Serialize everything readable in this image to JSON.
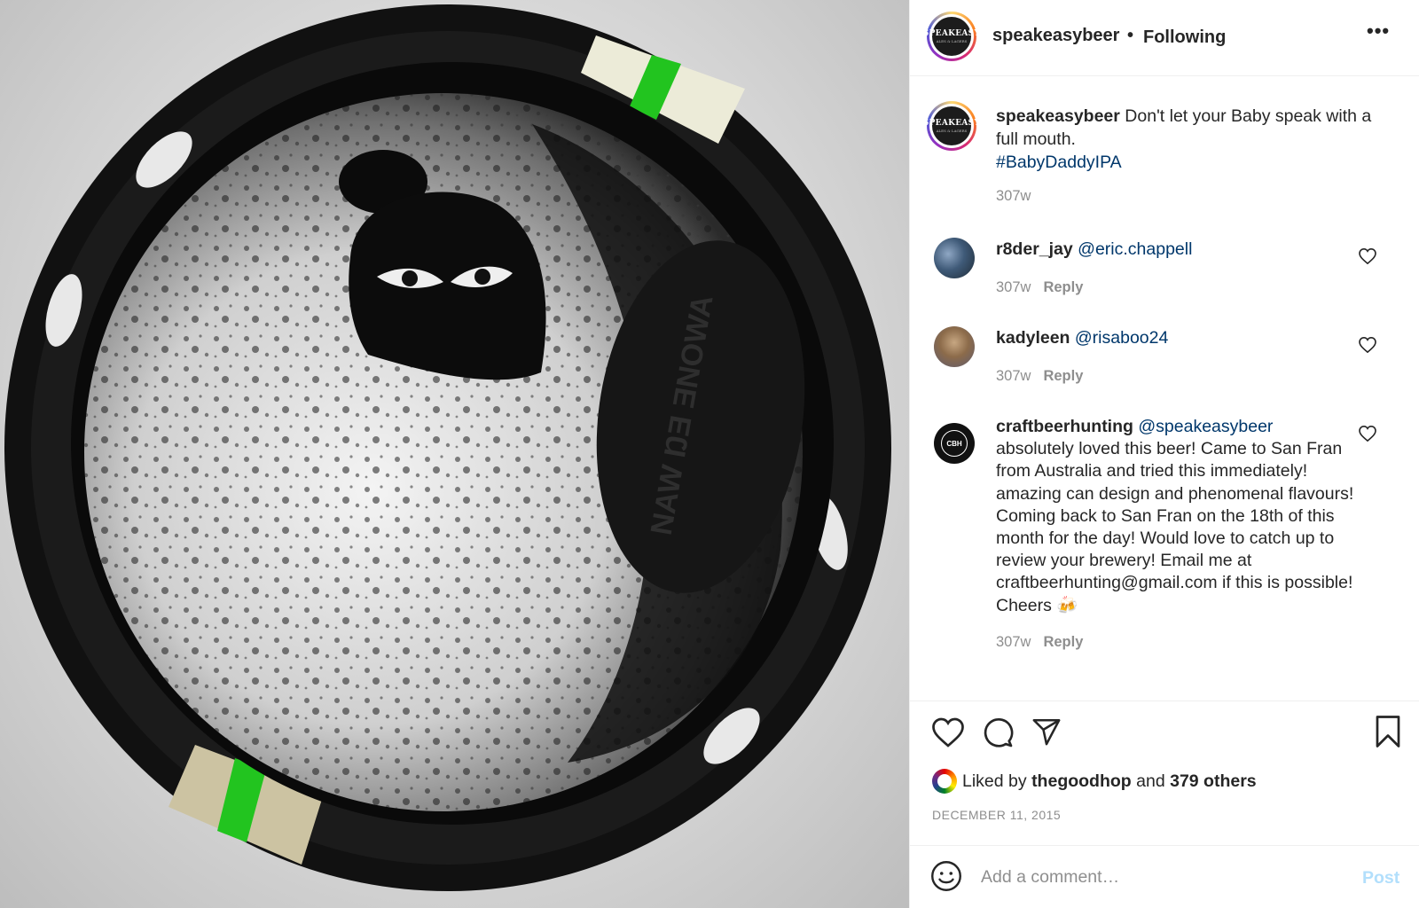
{
  "post": {
    "author": "speakeasybeer",
    "separator": "•",
    "follow_status": "Following",
    "more_icon": "•••",
    "avatar_text": "SPEAKEASY",
    "avatar_subtext": "ALES & LAGERS"
  },
  "caption": {
    "username": "speakeasybeer",
    "text": "Don't let your Baby speak with a full mouth.",
    "hashtag": "#BabyDaddyIPA",
    "age": "307w"
  },
  "comments": [
    {
      "username": "r8der_jay",
      "mention": "@eric.chappell",
      "text": "",
      "age": "307w",
      "reply_label": "Reply"
    },
    {
      "username": "kadyleen",
      "mention": "@risaboo24",
      "text": "",
      "age": "307w",
      "reply_label": "Reply"
    },
    {
      "username": "craftbeerhunting",
      "mention": "@speakeasybeer",
      "text": "absolutely loved this beer! Came to San Fran from Australia and tried this immediately! amazing can design and phenomenal flavours! Coming back to San Fran on the 18th of this month for the day! Would love to catch up to review your brewery! Email me at craftbeerhunting@gmail.com if this is possible! Cheers 🍻",
      "age": "307w",
      "reply_label": "Reply",
      "avatar_text": "CBH"
    }
  ],
  "likes": {
    "prefix": "Liked by",
    "user": "thegoodhop",
    "conjunction": "and",
    "others": "379 others"
  },
  "date": "DECEMBER 11, 2015",
  "add_comment": {
    "placeholder": "Add a comment…",
    "post_label": "Post"
  },
  "photo": {
    "can_lid_text": "NAW ŊƎ ƎNOWA"
  },
  "icons": {
    "like": "heart-icon",
    "comment": "comment-bubble-icon",
    "share": "paper-plane-icon",
    "save": "bookmark-icon",
    "emoji": "smiley-icon",
    "more": "ellipsis-icon"
  },
  "colors": {
    "link": "#00376b",
    "secondary_text": "#8e8e8e",
    "post_button_disabled": "#b2dffc",
    "can_stripe_green": "#22c41f"
  }
}
